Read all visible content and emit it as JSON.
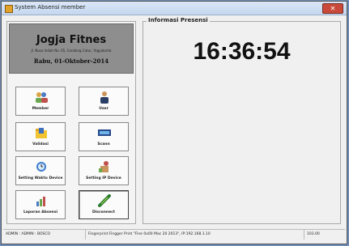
{
  "window": {
    "title": "System Absensi member"
  },
  "header": {
    "gym_name": "Jogja Fitnes",
    "address": "Jl. Nusa Indah No. 05, Condong Catur, Yogyakarta",
    "date": "Rabu,   01-Oktober-2014"
  },
  "buttons": [
    {
      "label": "Member",
      "icon": "members-icon"
    },
    {
      "label": "User",
      "icon": "user-icon"
    },
    {
      "label": "Validasi",
      "icon": "folder-icon"
    },
    {
      "label": "Scann",
      "icon": "scanner-icon"
    },
    {
      "label": "Setting Waktu Device",
      "icon": "clock-device-icon"
    },
    {
      "label": "Setting IP Device",
      "icon": "ip-device-icon"
    },
    {
      "label": "Laporan Absensi",
      "icon": "report-chart-icon"
    },
    {
      "label": "Disconnect",
      "icon": "disconnect-plug-icon"
    }
  ],
  "presensi": {
    "title": "Informasi Presensi",
    "time": "16:36:54"
  },
  "status": {
    "user": "ADMIN : ADMIN : BOSCO",
    "message": "Fingerprint Fingger Print \"Fine 0x00 Mac 20 2013\", IP:192.168.1.10",
    "code": "103.00"
  },
  "colors": {
    "header_bg": "#8e8e8e",
    "titlebar": "#c4d7ef",
    "close": "#c94a3a"
  }
}
